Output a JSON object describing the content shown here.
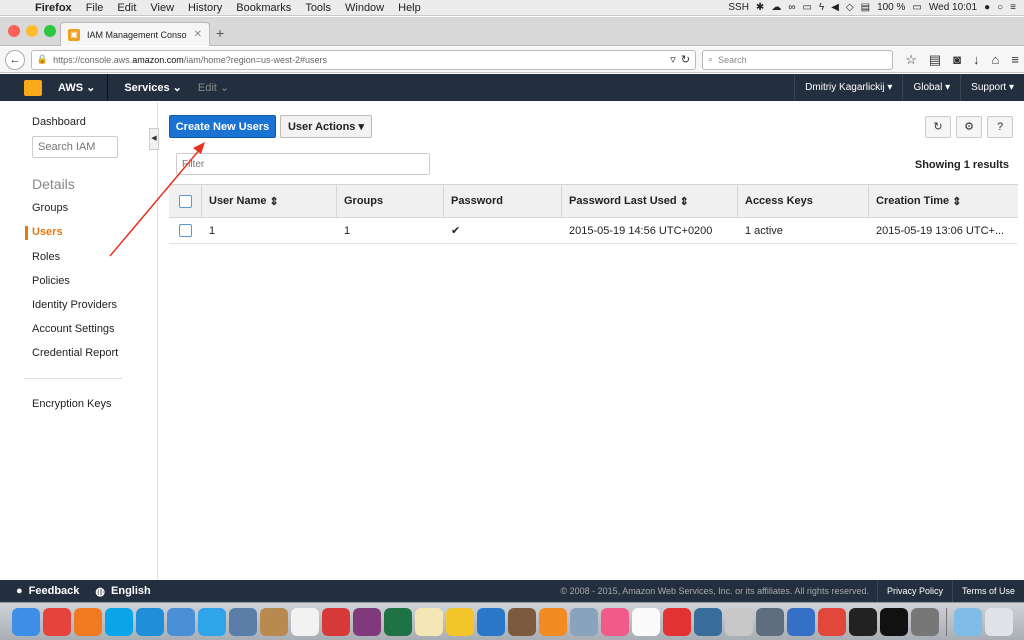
{
  "menubar": {
    "app": "Firefox",
    "items": [
      "File",
      "Edit",
      "View",
      "History",
      "Bookmarks",
      "Tools",
      "Window",
      "Help"
    ],
    "ssh": "SSH",
    "battery": "100 %",
    "clock": "Wed 10:01"
  },
  "browser": {
    "tab_title": "IAM Management Console",
    "url_prefix": "https://console.aws.",
    "url_domain": "amazon.com",
    "url_path": "/iam/home?region=us-west-2#users",
    "search_placeholder": "Search"
  },
  "aws_header": {
    "aws": "AWS",
    "services": "Services",
    "edit": "Edit",
    "user": "Dmitriy Kagarlickij",
    "region": "Global",
    "support": "Support"
  },
  "sidebar": {
    "dashboard": "Dashboard",
    "search_placeholder": "Search IAM",
    "heading": "Details",
    "items": [
      "Groups",
      "Users",
      "Roles",
      "Policies",
      "Identity Providers",
      "Account Settings",
      "Credential Report"
    ],
    "extra": "Encryption Keys"
  },
  "toolbar": {
    "create_label": "Create New Users",
    "actions_label": "User Actions"
  },
  "filter_placeholder": "Filter",
  "results_text": "Showing 1 results",
  "table": {
    "headers": [
      "User Name",
      "Groups",
      "Password",
      "Password Last Used",
      "Access Keys",
      "Creation Time"
    ],
    "rows": [
      {
        "user": "1",
        "groups": "1",
        "password": "✔",
        "last_used": "2015-05-19 14:56 UTC+0200",
        "keys": "1 active",
        "created": "2015-05-19 13:06 UTC+..."
      }
    ]
  },
  "footer": {
    "feedback": "Feedback",
    "language": "English",
    "copyright": "© 2008 - 2015, Amazon Web Services, Inc. or its affiliates. All rights reserved.",
    "privacy": "Privacy Policy",
    "terms": "Terms of Use"
  },
  "colors": {
    "aws_header": "#232f3e",
    "primary_button": "#1a73d2",
    "active_nav": "#e47911",
    "annotation_arrow": "#e8331c"
  }
}
